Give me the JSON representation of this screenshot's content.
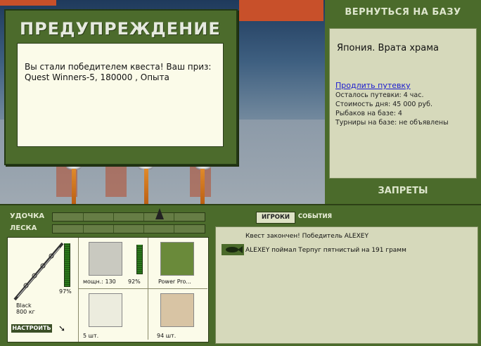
{
  "warning": {
    "title": "ПРЕДУПРЕЖДЕНИЕ",
    "message": "Вы стали победителем квеста! Ваш приз: Quest Winners-5, 180000 , Опыта"
  },
  "base": {
    "return_button": "ВЕРНУТЬСЯ НА БАЗУ",
    "location": "Япония. Врата храма",
    "extend_link": "Продлить путевку",
    "stats": [
      "Осталось путевки: 4 час.",
      "Стоимость дня: 45 000 руб.",
      "Рыбаков на базе: 4"
    ],
    "tournaments": "Турниры на базе: не объявлены",
    "bans_button": "ЗАПРЕТЫ"
  },
  "meters": {
    "rod_label": "УДОЧКА",
    "line_label": "ЛЕСКА"
  },
  "gear": {
    "rod_name": "Black",
    "rod_weight": "800 кг",
    "rod_percent": "97%",
    "rod_level": 0.97,
    "reel_power": "мощн.: 130",
    "reel_percent": "92%",
    "reel_level": 0.92,
    "line_name": "Power Pro...",
    "float_count": "5 шт.",
    "bait_count": "94 шт.",
    "tune_button": "НАСТРОИТЬ"
  },
  "events": {
    "tab_players": "ИГРОКИ",
    "tab_events": "СОБЫТИЯ",
    "lines": [
      "Квест закончен! Победитель ALEXEY",
      "ALEXEY поймал Терпуг пятнистый на 191 грамм"
    ]
  },
  "colors": {
    "panel_green": "#4b6b2b",
    "cream": "#fbfbe9",
    "link_blue": "#1a1ad0"
  }
}
